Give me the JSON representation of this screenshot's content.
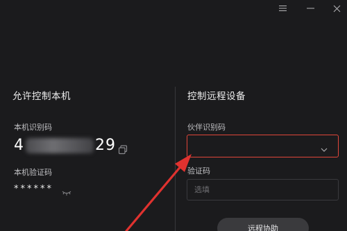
{
  "titlebar": {
    "menu_icon": "menu-icon",
    "minimize_icon": "minimize-icon",
    "close_icon": "close-icon"
  },
  "allow_control": {
    "title": "允许控制本机",
    "id_label": "本机识别码",
    "id_value_start": "4",
    "id_value_end": "29",
    "password_label": "本机验证码",
    "password_value": "******",
    "copy_icon": "copy-icon",
    "eye_icon": "eye-closed-icon"
  },
  "remote_control": {
    "title": "控制远程设备",
    "partner_label": "伙伴识别码",
    "partner_value": "",
    "code_label": "验证码",
    "code_placeholder": "选填",
    "connect_label": "远程协助",
    "chevron_icon": "chevron-down-icon"
  },
  "annotation": {
    "arrow_color": "#e0322f"
  }
}
